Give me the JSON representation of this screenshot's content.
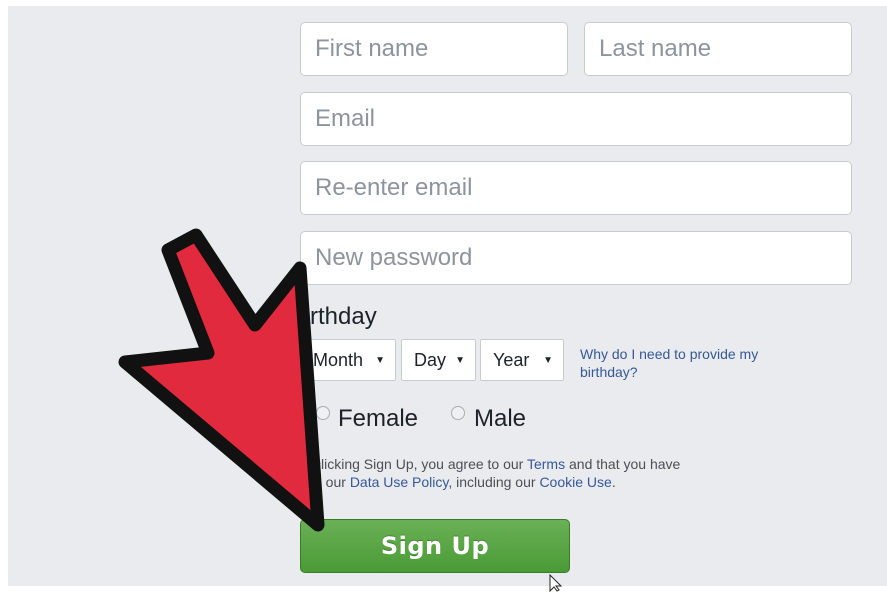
{
  "form": {
    "first_name": {
      "placeholder": "First name",
      "value": ""
    },
    "last_name": {
      "placeholder": "Last name",
      "value": ""
    },
    "email": {
      "placeholder": "Email",
      "value": ""
    },
    "reenter_email": {
      "placeholder": "Re-enter email",
      "value": ""
    },
    "new_password": {
      "placeholder": "New password",
      "value": ""
    },
    "birthday_label": "rthday",
    "birthday": {
      "month": "Month",
      "day": "Day",
      "year": "Year",
      "help_line1": "Why do I need to provide my",
      "help_line2": "birthday?"
    },
    "gender": {
      "female": "Female",
      "male": "Male"
    },
    "terms": {
      "line1_a": "clicking Sign Up, you agree to our ",
      "line1_link": "Terms",
      "line1_b": " and that you have",
      "line2_a": "d our ",
      "line2_link1": "Data Use Policy",
      "line2_b": ", including our ",
      "line2_link2": "Cookie Use",
      "line2_c": "."
    },
    "signup_label": "Sign Up"
  },
  "colors": {
    "background": "#e9ebee",
    "link": "#365899",
    "signup_button": "#4a9a36",
    "arrow": "#e22a3e"
  },
  "icons": {
    "caret": "caret-down-icon",
    "arrow": "red-arrow-annotation",
    "cursor": "mouse-pointer-icon"
  }
}
